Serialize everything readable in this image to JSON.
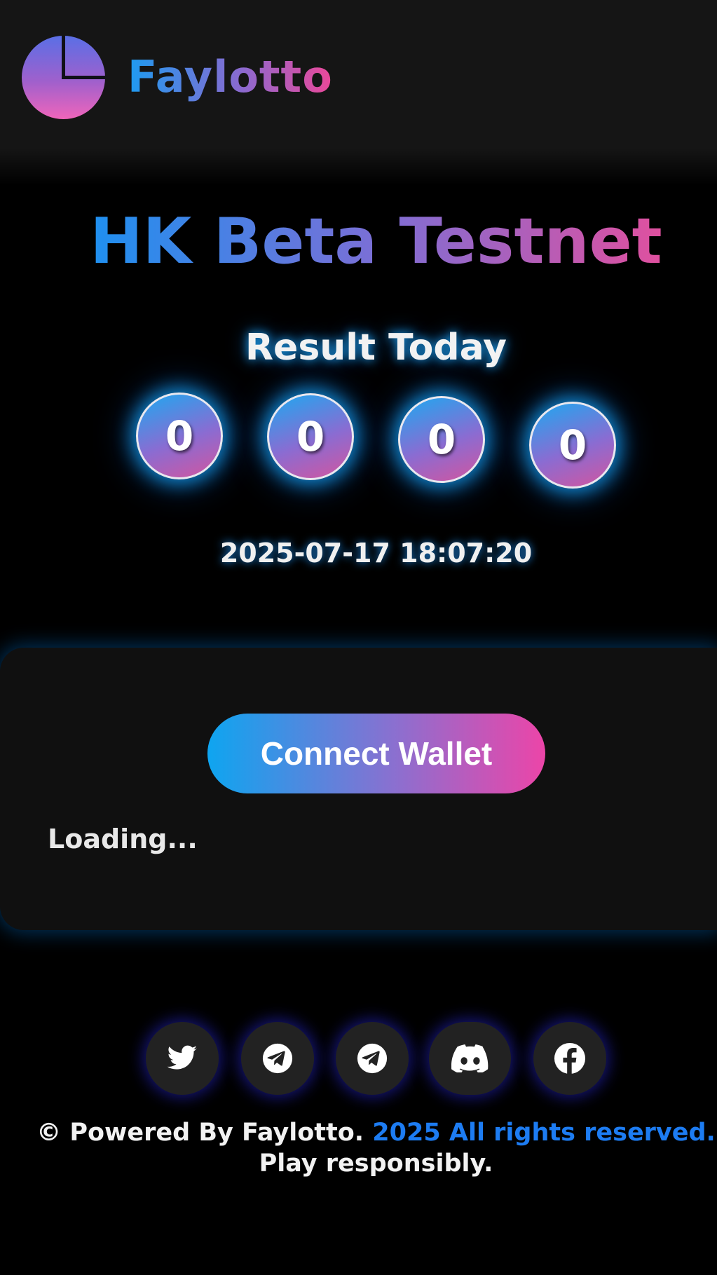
{
  "header": {
    "brand": "Faylotto",
    "logo_icon": "pie-chart-icon"
  },
  "hero": {
    "title": "HK Beta Testnet",
    "result_label": "Result Today",
    "numbers": [
      "0",
      "0",
      "0",
      "0"
    ],
    "datetime": "2025-07-17 18:07:20"
  },
  "panel": {
    "connect_label": "Connect Wallet",
    "status_text": "Loading..."
  },
  "social": [
    {
      "icon": "twitter-icon"
    },
    {
      "icon": "telegram-icon"
    },
    {
      "icon": "telegram-icon"
    },
    {
      "icon": "discord-icon"
    },
    {
      "icon": "facebook-icon"
    }
  ],
  "footer": {
    "part1": "© Powered By Faylotto.",
    "highlight": "2025 All rights reserved.",
    "part2": "Play responsibly."
  },
  "colors": {
    "background": "#000000",
    "header_bg": "#151515",
    "panel_bg": "#101010",
    "accent_blue": "#1d9bf0",
    "accent_pink": "#ec4899",
    "link_blue": "#1d7cf2"
  }
}
